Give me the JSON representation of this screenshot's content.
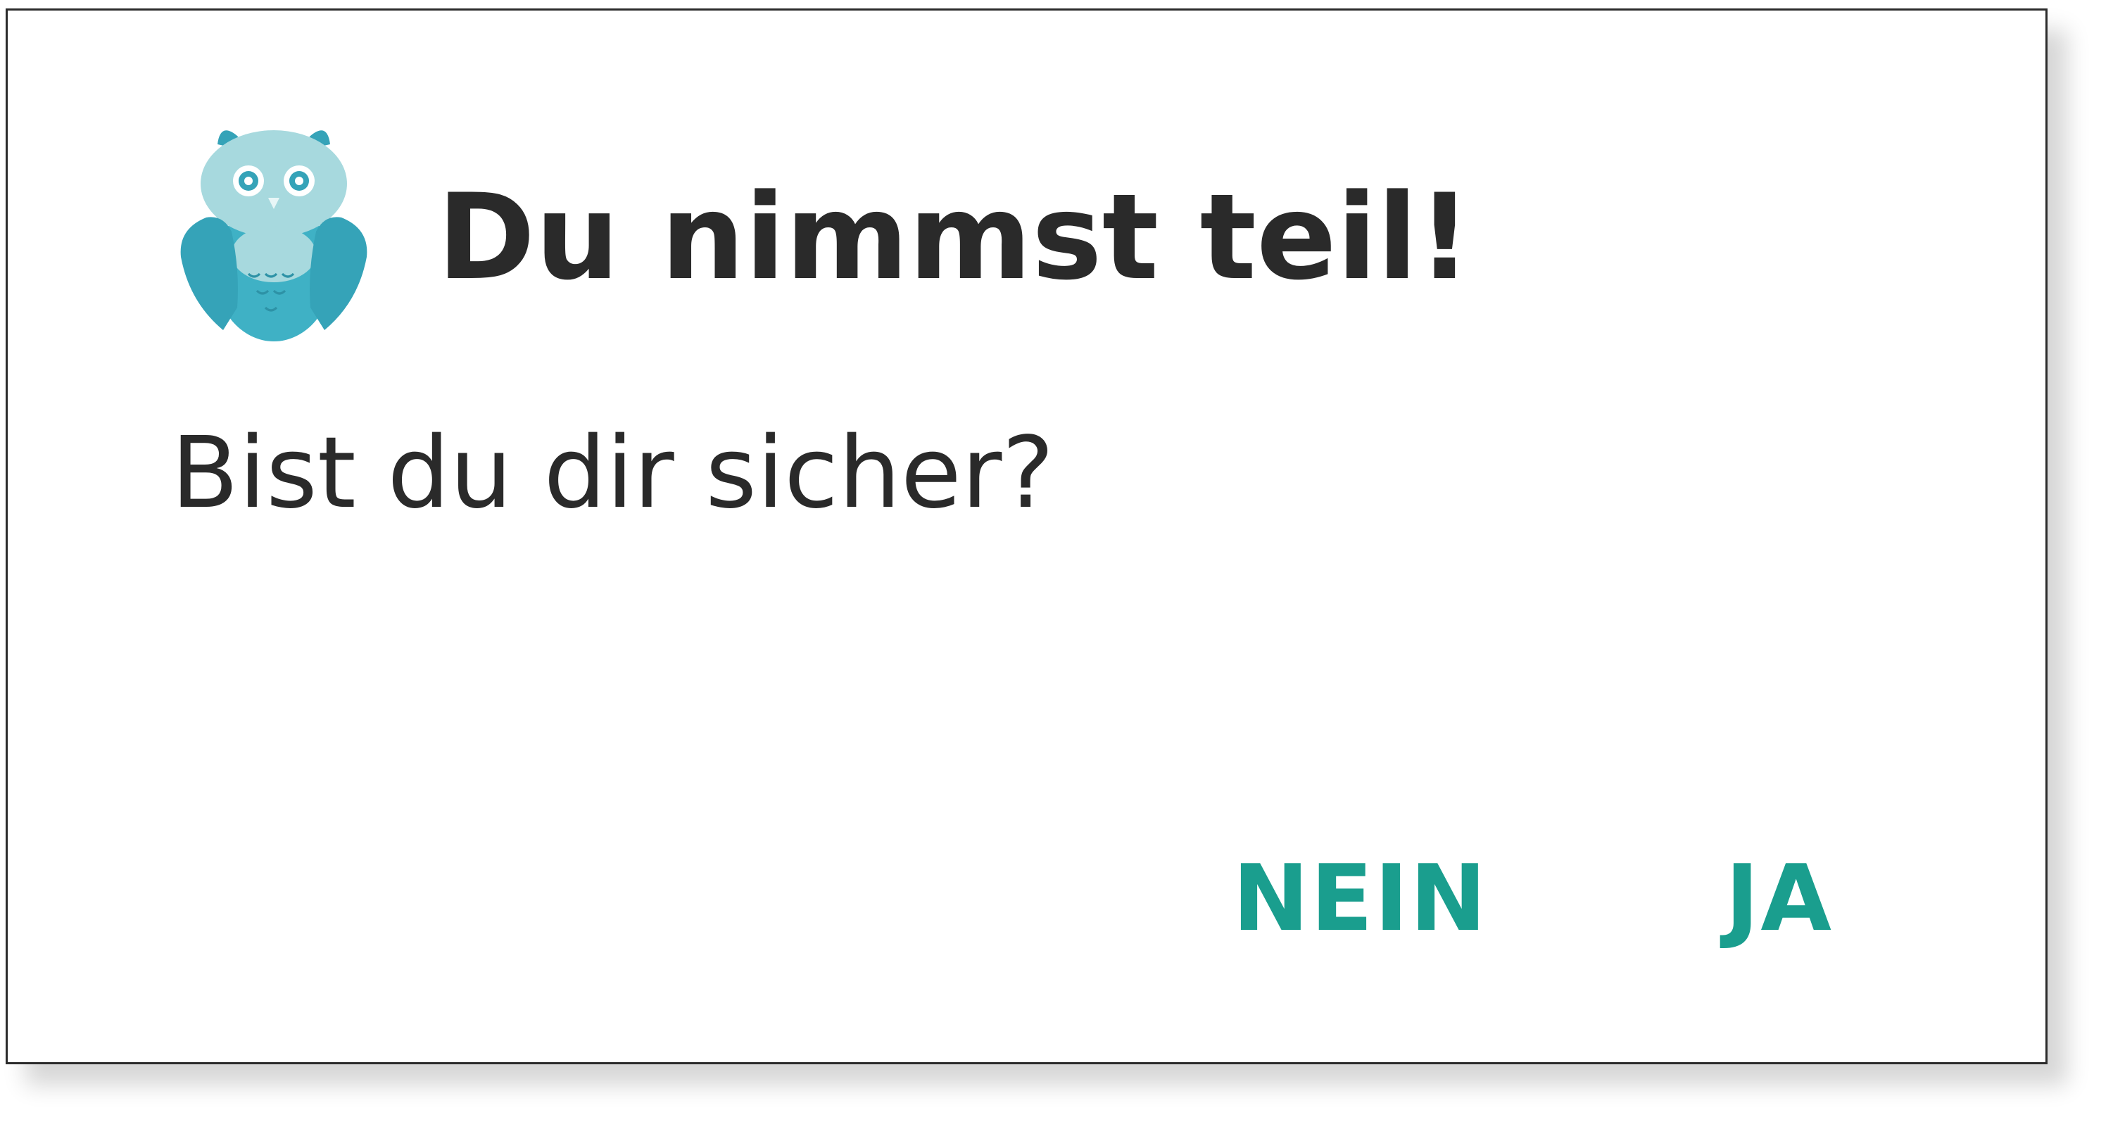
{
  "dialog": {
    "title": "Du nimmst teil!",
    "message": "Bist du dir sicher?",
    "icon": "owl-icon",
    "buttons": {
      "no_label": "NEIN",
      "yes_label": "JA"
    }
  },
  "colors": {
    "accent": "#1a9e8e",
    "text": "#2a2a2a",
    "owl_light": "#a7d9de",
    "owl_dark": "#35a3b8"
  }
}
